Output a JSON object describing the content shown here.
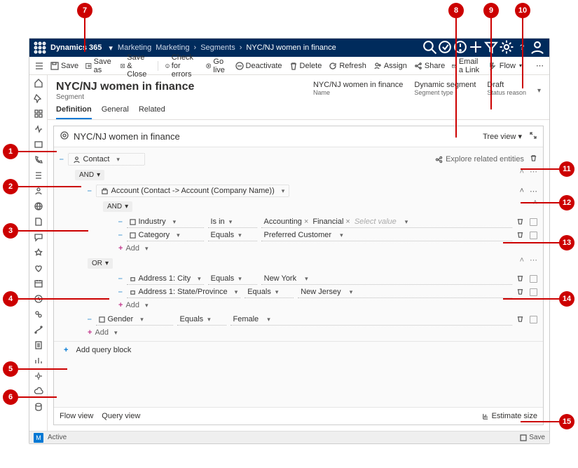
{
  "topbar": {
    "brand": "Dynamics 365",
    "area": "Marketing",
    "breadcrumbs": [
      "Marketing",
      "Segments",
      "NYC/NJ women in finance"
    ]
  },
  "commands": {
    "save": "Save",
    "saveas": "Save as",
    "saveclose": "Save & Close",
    "check": "Check for errors",
    "golive": "Go live",
    "deactivate": "Deactivate",
    "delete": "Delete",
    "refresh": "Refresh",
    "assign": "Assign",
    "share": "Share",
    "emaillink": "Email a Link",
    "flow": "Flow"
  },
  "record": {
    "title": "NYC/NJ women in finance",
    "subtitle": "Segment",
    "fields": {
      "name": {
        "val": "NYC/NJ women in finance",
        "lbl": "Name"
      },
      "type": {
        "val": "Dynamic segment",
        "lbl": "Segment type"
      },
      "status": {
        "val": "Draft",
        "lbl": "Status reason"
      }
    }
  },
  "tabs": {
    "definition": "Definition",
    "general": "General",
    "related": "Related"
  },
  "designer": {
    "title": "NYC/NJ women in finance",
    "treeview": "Tree view",
    "explore": "Explore related entities",
    "root_entity": "Contact",
    "and": "AND",
    "or": "OR",
    "sub_entity": "Account (Contact -> Account (Company Name))",
    "fields": {
      "industry": "Industry",
      "category": "Category",
      "city": "Address 1: City",
      "state": "Address 1: State/Province",
      "gender": "Gender"
    },
    "ops": {
      "isin": "Is in",
      "equals": "Equals"
    },
    "vals": {
      "accounting": "Accounting",
      "financial": "Financial",
      "selectvalue": "Select value",
      "preferred": "Preferred Customer",
      "newyork": "New York",
      "newjersey": "New Jersey",
      "female": "Female"
    },
    "add": "Add",
    "addblock": "Add query block",
    "flowview": "Flow view",
    "queryview": "Query view",
    "estimate": "Estimate size"
  },
  "status": {
    "active": "Active",
    "save": "Save",
    "M": "M"
  },
  "callouts": [
    "1",
    "2",
    "3",
    "4",
    "5",
    "6",
    "7",
    "8",
    "9",
    "10",
    "11",
    "12",
    "13",
    "14",
    "15"
  ]
}
